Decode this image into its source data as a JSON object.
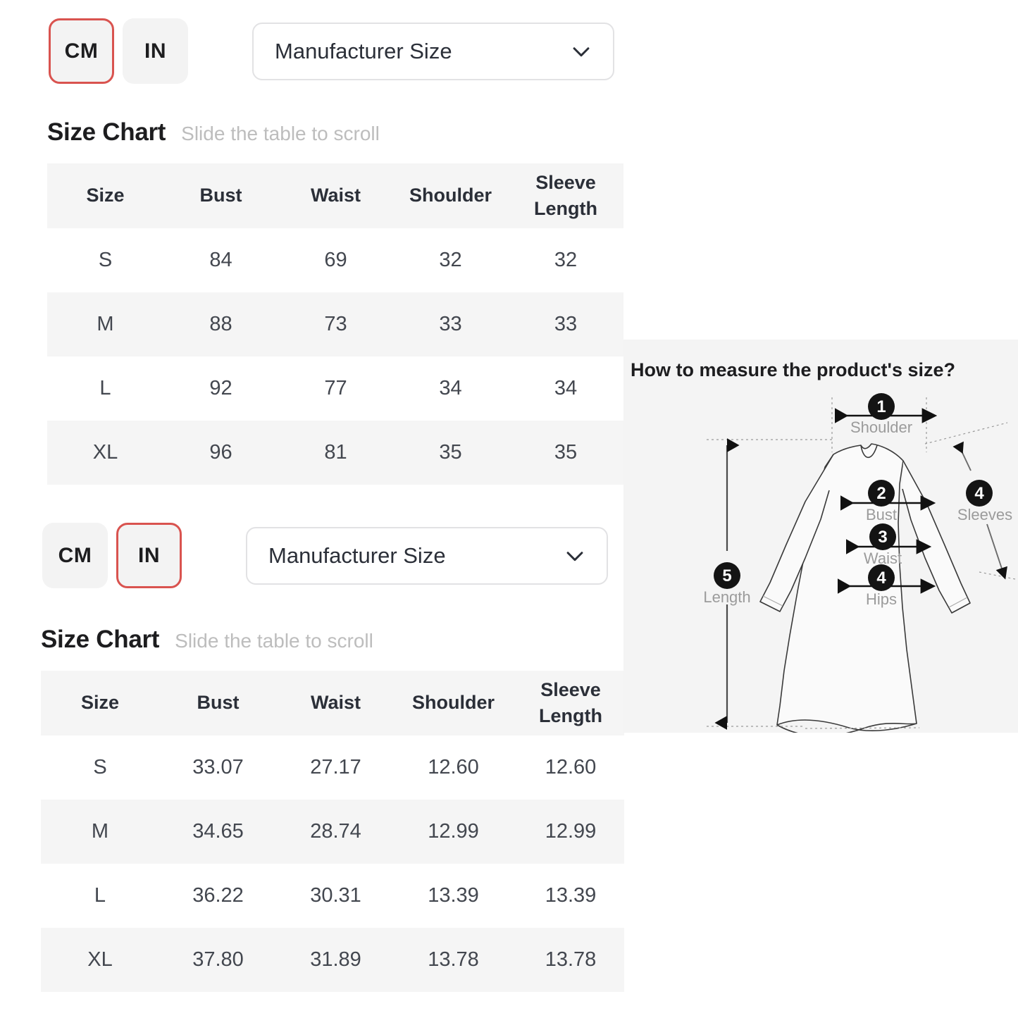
{
  "sections": [
    {
      "id": "cm",
      "units": [
        {
          "label": "CM",
          "selected": true
        },
        {
          "label": "IN",
          "selected": false
        }
      ],
      "dropdown": {
        "value": "Manufacturer Size",
        "icon": "chevron-down-icon"
      },
      "heading": {
        "title": "Size Chart",
        "hint": "Slide the table to scroll"
      },
      "table": {
        "columns": [
          "Size",
          "Bust",
          "Waist",
          "Shoulder",
          "Sleeve Length"
        ],
        "rows": [
          [
            "S",
            "84",
            "69",
            "32",
            "32"
          ],
          [
            "M",
            "88",
            "73",
            "33",
            "33"
          ],
          [
            "L",
            "92",
            "77",
            "34",
            "34"
          ],
          [
            "XL",
            "96",
            "81",
            "35",
            "35"
          ]
        ]
      }
    },
    {
      "id": "in",
      "units": [
        {
          "label": "CM",
          "selected": false
        },
        {
          "label": "IN",
          "selected": true
        }
      ],
      "dropdown": {
        "value": "Manufacturer Size",
        "icon": "chevron-down-icon"
      },
      "heading": {
        "title": "Size Chart",
        "hint": "Slide the table to scroll"
      },
      "table": {
        "columns": [
          "Size",
          "Bust",
          "Waist",
          "Shoulder",
          "Sleeve Length"
        ],
        "rows": [
          [
            "S",
            "33.07",
            "27.17",
            "12.60",
            "12.60"
          ],
          [
            "M",
            "34.65",
            "28.74",
            "12.99",
            "12.99"
          ],
          [
            "L",
            "36.22",
            "30.31",
            "13.39",
            "13.39"
          ],
          [
            "XL",
            "37.80",
            "31.89",
            "13.78",
            "13.78"
          ]
        ]
      }
    }
  ],
  "measure": {
    "title": "How to measure the product's size?",
    "labels": {
      "shoulder": {
        "number": "1",
        "text": "Shoulder"
      },
      "bust": {
        "number": "2",
        "text": "Bust"
      },
      "waist": {
        "number": "3",
        "text": "Waist"
      },
      "hips": {
        "number": "4",
        "text": "Hips"
      },
      "sleeves": {
        "number": "4",
        "text": "Sleeves"
      },
      "length": {
        "number": "5",
        "text": "Length"
      }
    }
  },
  "colors": {
    "accent_selected": "#d9534f",
    "table_header_bg": "#f5f5f5",
    "panel_bg": "#f4f4f4",
    "text": "#2b2f38",
    "hint": "#bdbdbd"
  }
}
